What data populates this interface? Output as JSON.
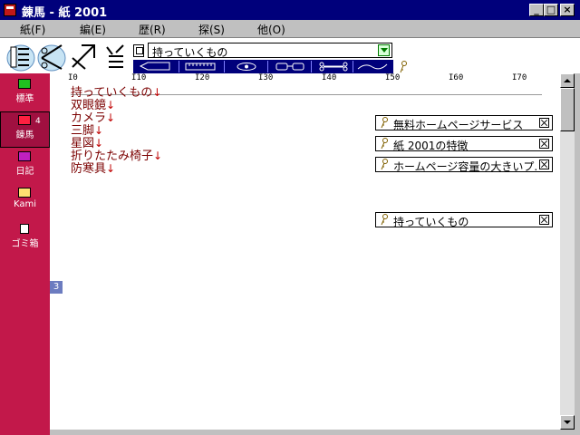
{
  "window": {
    "title": "錬馬 - 紙 2001",
    "minimize_glyph": "_",
    "maximize_glyph": "□",
    "close_glyph": "×"
  },
  "menu": [
    "紙(F)",
    "編(E)",
    "歴(R)",
    "探(S)",
    "他(O)"
  ],
  "toolbar": {
    "tool_icons": [
      "pencil-hat-icon",
      "scissors-hat-icon",
      "arrow-hat-icon",
      "brush-hat-icon"
    ],
    "title_value": "持っていくもの",
    "strip_tools": [
      "pen-tool-icon",
      "ruler-tool-icon",
      "eye-tool-icon",
      "glasses-tool-icon",
      "bone-tool-icon",
      "rope-tool-icon"
    ],
    "key_icon": "key-icon"
  },
  "sidebar": {
    "items": [
      {
        "label": "標準",
        "icon": "green-folder-icon",
        "color": "#20c020"
      },
      {
        "label": "錬馬",
        "icon": "mail-icon",
        "color": "#ff2040",
        "badge": "4"
      },
      {
        "label": "日記",
        "icon": "purple-folder-icon",
        "color": "#c020c0"
      },
      {
        "label": "Kami",
        "icon": "yellow-folder-icon",
        "color": "#ffe070"
      },
      {
        "label": "ゴミ箱",
        "icon": "trash-icon",
        "color": "#ffffff"
      }
    ]
  },
  "ruler": {
    "labels": [
      "I0",
      "I10",
      "I20",
      "I30",
      "I40",
      "I50",
      "I60",
      "I70"
    ]
  },
  "editor": {
    "lines": [
      "持っていくもの",
      "双眼鏡",
      "カメラ",
      "三脚",
      "星図",
      "折りたたみ椅子",
      "防寒具"
    ],
    "line_marker": "↓",
    "line_count": "3"
  },
  "link_cards": [
    {
      "text": "無料ホームページサービス"
    },
    {
      "text": "紙 2001の特徴"
    },
    {
      "text": "ホームページ容量の大きいプ..."
    },
    {
      "text": "持っていくもの"
    }
  ],
  "colors": {
    "titlebar": "#00007b",
    "sidebar": "#c2184a",
    "text": "#7b0000"
  }
}
